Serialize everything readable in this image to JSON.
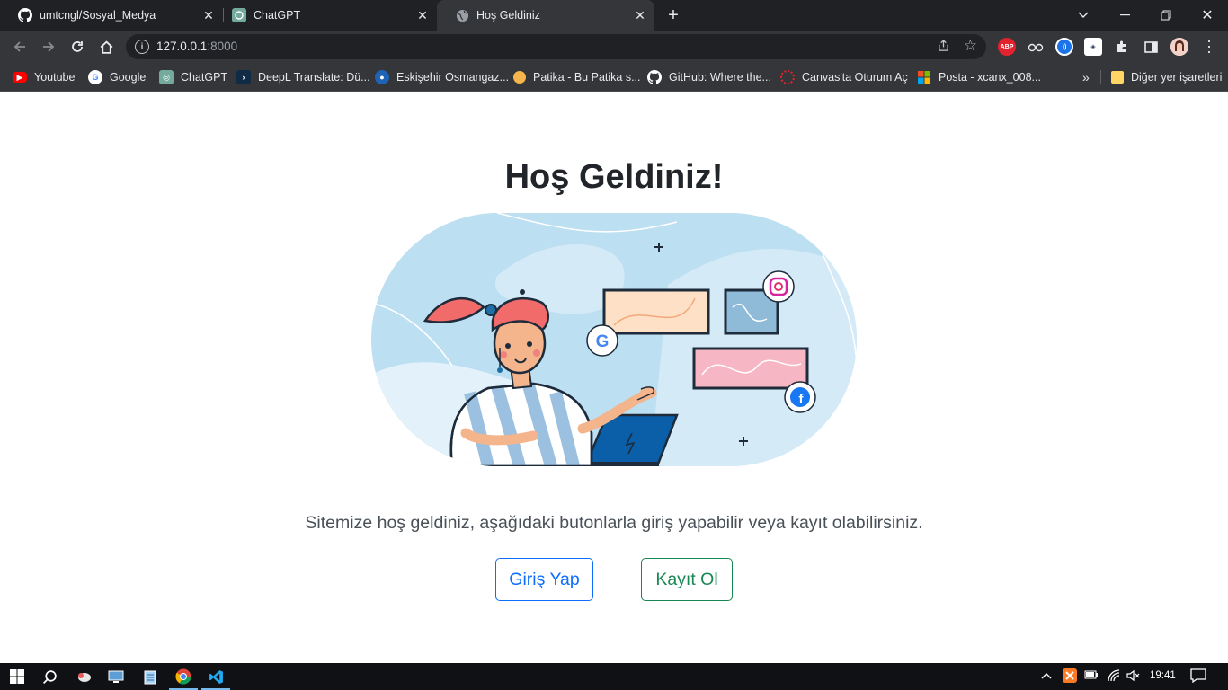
{
  "tabs": [
    {
      "title": "umtcngl/Sosyal_Medya",
      "icon": "github-icon"
    },
    {
      "title": "ChatGPT",
      "icon": "chatgpt-icon"
    },
    {
      "title": "Hoş Geldiniz",
      "icon": "globe-icon"
    }
  ],
  "address": {
    "host": "127.0.0.1",
    "port": ":8000"
  },
  "extensions": {
    "abp_label": "ABP"
  },
  "bookmarks": [
    {
      "label": "Youtube",
      "color": "#ff0000"
    },
    {
      "label": "Google",
      "color": "#4285f4"
    },
    {
      "label": "ChatGPT",
      "color": "#74aa9c"
    },
    {
      "label": "DeepL Translate: Dü...",
      "color": "#0f2b46"
    },
    {
      "label": "Eskişehir Osmangaz...",
      "color": "#1e63b5"
    },
    {
      "label": "Patika - Bu Patika s...",
      "color": "#f6b44c"
    },
    {
      "label": "GitHub: Where the...",
      "color": "#ffffff"
    },
    {
      "label": "Canvas'ta Oturum Aç",
      "color": "#e4252b"
    },
    {
      "label": "Posta - xcanx_008...",
      "color": "#0078d4"
    }
  ],
  "bookmarks_other": "Diğer yer işaretleri",
  "page": {
    "title": "Hoş Geldiniz!",
    "lead": "Sitemize hoş geldiniz, aşağıdaki butonlarla giriş yapabilir veya kayıt olabilirsiniz.",
    "login_label": "Giriş Yap",
    "register_label": "Kayıt Ol"
  },
  "colors": {
    "primary": "#0d6efd",
    "success": "#198754",
    "chrome_dark": "#202124",
    "chrome_toolbar": "#35363a"
  },
  "taskbar": {
    "time": "19:41"
  }
}
